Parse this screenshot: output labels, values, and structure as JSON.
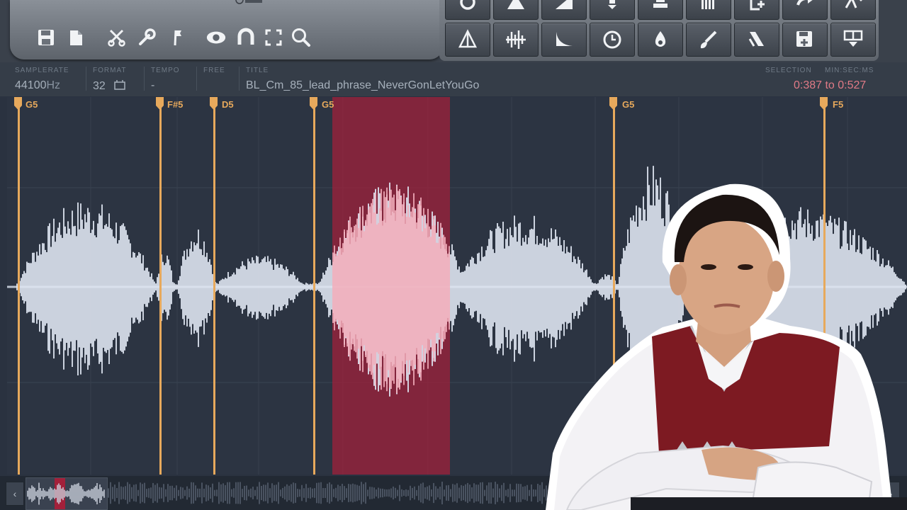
{
  "info": {
    "samplerate_label": "SAMPLERATE",
    "samplerate_value": "44100",
    "samplerate_unit": "Hz",
    "format_label": "FORMAT",
    "format_value": "32",
    "tempo_label": "TEMPO",
    "tempo_value": "-",
    "free_label": "FREE",
    "title_label": "TITLE",
    "title_value": "BL_Cm_85_lead_phrase_NeverGonLetYouGo",
    "selection_label": "SELECTION",
    "minsec_label": "MIN:SEC:MS",
    "selection_value": "0:387 to 0:527"
  },
  "markers": [
    "G5",
    "F#5",
    "D5",
    "G5",
    "G5",
    "F5"
  ],
  "toolbar_icons": [
    "save-icon",
    "copy-icon",
    "scissors-icon",
    "wrench-icon",
    "flag-icon",
    "eye-icon",
    "magnet-icon",
    "fullscreen-icon",
    "zoom-icon"
  ],
  "tool_grid_icons": [
    "loop-icon",
    "spike-icon",
    "fade-in-icon",
    "arrow-down-icon",
    "stamp-icon",
    "equalizer-icon",
    "add-icon",
    "redo-icon",
    "wave-edit-icon",
    "triangle-icon",
    "waveform-icon",
    "decay-icon",
    "clock-icon",
    "drop-icon",
    "brush-icon",
    "pitch-icon",
    "save-new-icon",
    "split-icon"
  ],
  "colors": {
    "selection": "#a3203a",
    "marker": "#e7a95c",
    "waveform": "#dde3ef",
    "selection_text": "#e07a86"
  },
  "scroll": {
    "left": "‹",
    "right": "›"
  }
}
